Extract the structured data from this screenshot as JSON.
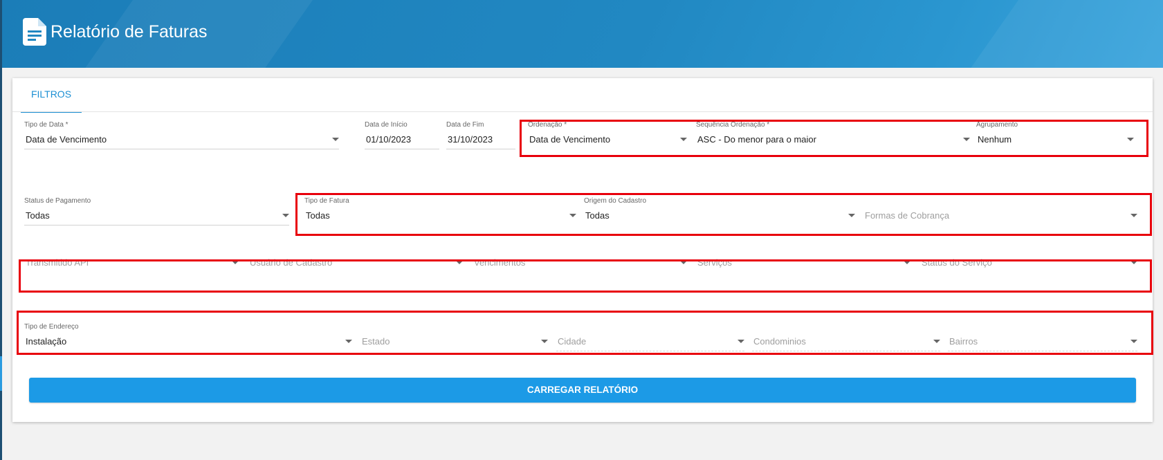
{
  "header": {
    "title": "Relatório de Faturas",
    "icon": "document-icon"
  },
  "tabs": [
    {
      "label": "FILTROS",
      "active": true
    }
  ],
  "row1": {
    "tipo_data": {
      "label": "Tipo de Data *",
      "value": "Data de Vencimento"
    },
    "data_inicio": {
      "label": "Data de Início",
      "value": "01/10/2023"
    },
    "data_fim": {
      "label": "Data de Fim",
      "value": "31/10/2023"
    },
    "ordenacao": {
      "label": "Ordenação *",
      "value": "Data de Vencimento"
    },
    "sequencia": {
      "label": "Sequência Ordenação *",
      "value": "ASC - Do menor para o maior"
    },
    "agrupamento": {
      "label": "Agrupamento",
      "value": "Nenhum"
    }
  },
  "row2": {
    "status_pagamento": {
      "label": "Status de Pagamento",
      "value": "Todas"
    },
    "tipo_fatura": {
      "label": "Tipo de Fatura",
      "value": "Todas"
    },
    "origem_cadastro": {
      "label": "Origem do Cadastro",
      "value": "Todas"
    },
    "formas_cobranca": {
      "placeholder": "Formas de Cobrança"
    }
  },
  "row3": {
    "transmitido_api": {
      "placeholder": "Transmitido API"
    },
    "usuario_cadastro": {
      "placeholder": "Usuário de Cadastro"
    },
    "vencimentos": {
      "placeholder": "Vencimentos"
    },
    "servicos": {
      "placeholder": "Serviços"
    },
    "status_servico": {
      "placeholder": "Status do Serviço"
    }
  },
  "row4": {
    "tipo_endereco": {
      "label": "Tipo de Endereço",
      "value": "Instalação"
    },
    "estado": {
      "placeholder": "Estado"
    },
    "cidade": {
      "placeholder": "Cidade"
    },
    "condominios": {
      "placeholder": "Condominios"
    },
    "bairros": {
      "placeholder": "Bairros"
    }
  },
  "actions": {
    "load_report": "CARREGAR RELATÓRIO"
  },
  "colors": {
    "header": "#2188c2",
    "accent": "#1c9ae6",
    "highlight_box": "#e8000b"
  }
}
